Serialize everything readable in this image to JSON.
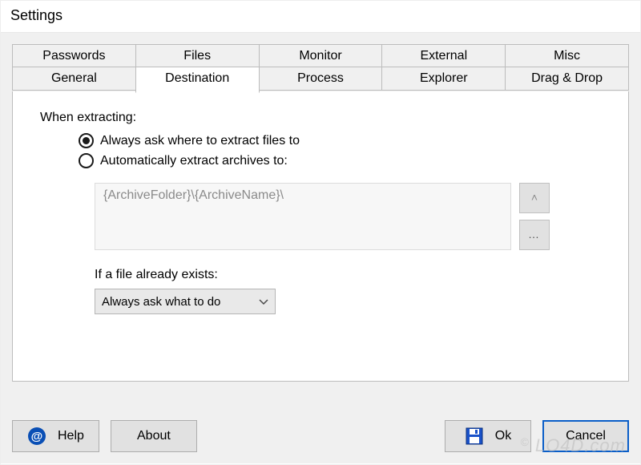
{
  "window": {
    "title": "Settings"
  },
  "tabs": {
    "row1": [
      "Passwords",
      "Files",
      "Monitor",
      "External",
      "Misc"
    ],
    "row2": [
      "General",
      "Destination",
      "Process",
      "Explorer",
      "Drag & Drop"
    ],
    "active": "Destination"
  },
  "panel": {
    "section_label": "When extracting:",
    "radio_always_ask": "Always ask where to extract files to",
    "radio_auto": "Automatically extract archives to:",
    "radio_selected": "always_ask",
    "path_value": "{ArchiveFolder}\\{ArchiveName}\\",
    "history_btn": "^",
    "browse_btn": "…",
    "exists_label": "If a file already exists:",
    "exists_value": "Always ask what to do"
  },
  "buttons": {
    "help": "Help",
    "about": "About",
    "ok": "Ok",
    "cancel": "Cancel"
  },
  "watermark": "LO4D.com"
}
